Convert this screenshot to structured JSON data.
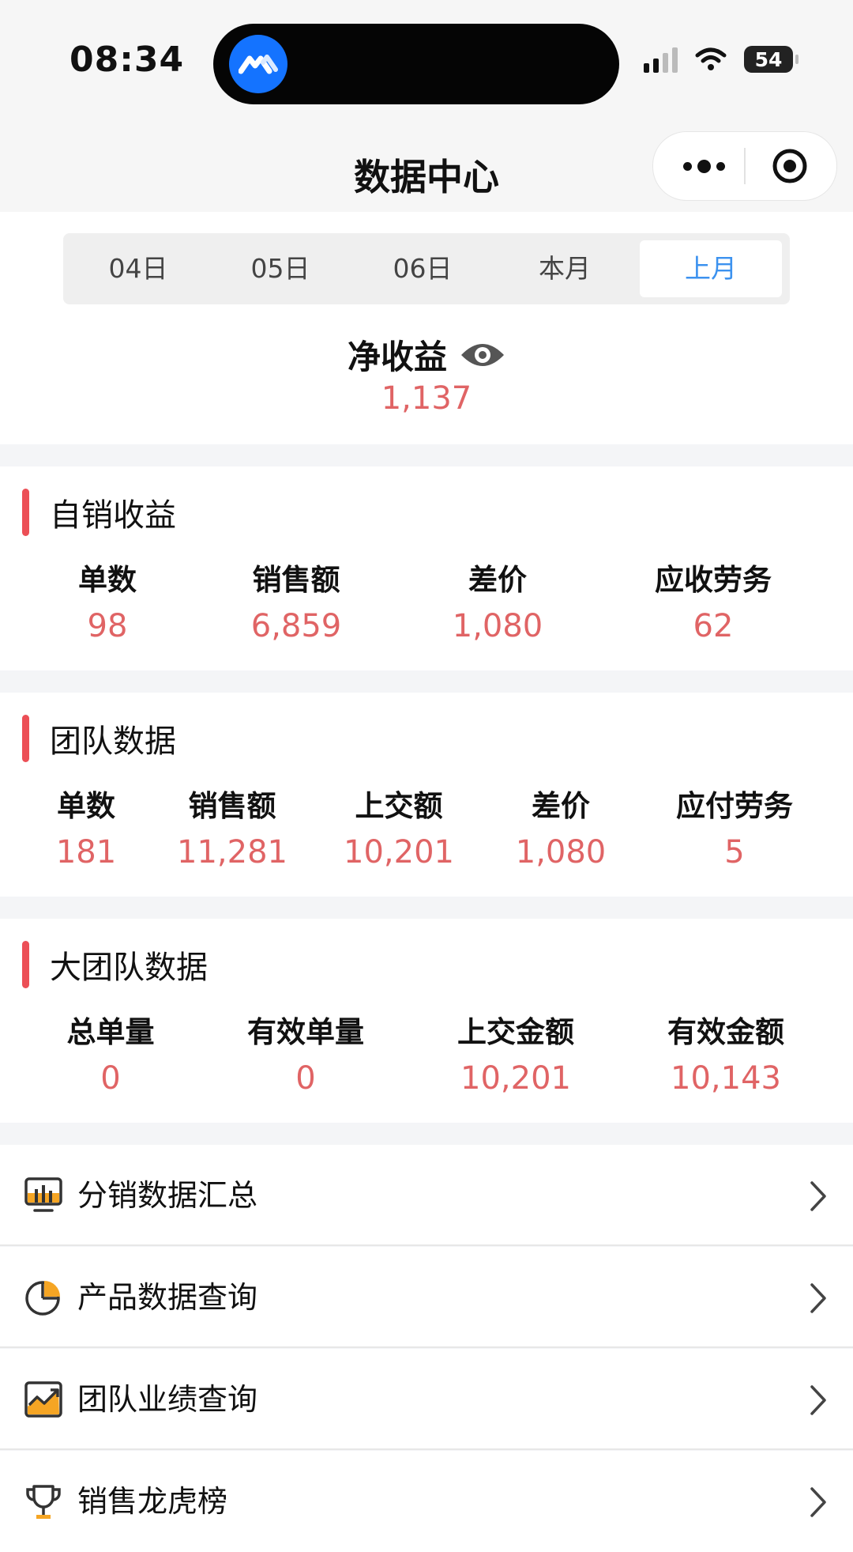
{
  "status_bar": {
    "time": "08:34",
    "battery": "54"
  },
  "nav": {
    "title": "数据中心"
  },
  "tabs": [
    {
      "label": "04日",
      "active": false
    },
    {
      "label": "05日",
      "active": false
    },
    {
      "label": "06日",
      "active": false
    },
    {
      "label": "本月",
      "active": false
    },
    {
      "label": "上月",
      "active": true
    }
  ],
  "summary": {
    "label": "净收益",
    "value": "1,137"
  },
  "self_sales": {
    "title": "自销收益",
    "metrics": [
      {
        "label": "单数",
        "value": "98"
      },
      {
        "label": "销售额",
        "value": "6,859"
      },
      {
        "label": "差价",
        "value": "1,080"
      },
      {
        "label": "应收劳务",
        "value": "62"
      }
    ]
  },
  "team": {
    "title": "团队数据",
    "metrics": [
      {
        "label": "单数",
        "value": "181"
      },
      {
        "label": "销售额",
        "value": "11,281"
      },
      {
        "label": "上交额",
        "value": "10,201"
      },
      {
        "label": "差价",
        "value": "1,080"
      },
      {
        "label": "应付劳务",
        "value": "5"
      }
    ]
  },
  "big_team": {
    "title": "大团队数据",
    "metrics": [
      {
        "label": "总单量",
        "value": "0"
      },
      {
        "label": "有效单量",
        "value": "0"
      },
      {
        "label": "上交金额",
        "value": "10,201"
      },
      {
        "label": "有效金额",
        "value": "10,143"
      }
    ]
  },
  "menu": [
    {
      "label": "分销数据汇总",
      "icon": "bar-chart-icon"
    },
    {
      "label": "产品数据查询",
      "icon": "pie-chart-icon"
    },
    {
      "label": "团队业绩查询",
      "icon": "trend-chart-icon"
    },
    {
      "label": "销售龙虎榜",
      "icon": "trophy-icon"
    }
  ],
  "colors": {
    "accent": "#e06465",
    "tab_active": "#3c92ef",
    "section_bar": "#ec4f56",
    "icon_orange": "#f5a524"
  }
}
